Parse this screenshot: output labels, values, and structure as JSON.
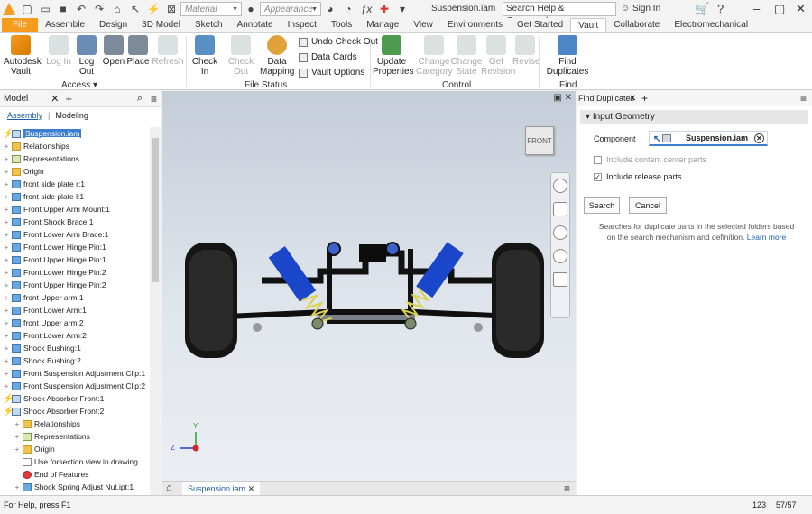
{
  "qat": {
    "material_placeholder": "Material",
    "appearance_placeholder": "Appearance",
    "doc_title": "Suspension.iam",
    "search_placeholder": "Search Help & Commands...",
    "signin": "Sign In"
  },
  "tabs": [
    "File",
    "Assemble",
    "Design",
    "3D Model",
    "Sketch",
    "Annotate",
    "Inspect",
    "Tools",
    "Manage",
    "View",
    "Environments",
    "Get Started",
    "Vault",
    "Collaborate",
    "Electromechanical"
  ],
  "active_tab": "Vault",
  "ribbon": {
    "autodesk_vault": "Autodesk Vault",
    "login": "Log In",
    "logout": "Log Out",
    "open": "Open",
    "place": "Place",
    "refresh": "Refresh",
    "checkin": "Check In",
    "checkout": "Check Out",
    "data_mapping": "Data Mapping",
    "undo_checkout": "Undo Check Out",
    "data_cards": "Data Cards",
    "vault_options": "Vault Options",
    "update_properties": "Update Properties",
    "change_category": "Change Category",
    "change_state": "Change State",
    "get_revision": "Get Revision",
    "revise": "Revise",
    "find_duplicates": "Find Duplicates",
    "panel_access": "Access",
    "panel_file_status": "File Status",
    "panel_control": "Control",
    "panel_find": "Find"
  },
  "browser": {
    "title": "Model",
    "subtab_assembly": "Assembly",
    "subtab_modeling": "Modeling",
    "nodes": [
      {
        "label": "Suspension.iam",
        "icon": "asm",
        "bolt": true,
        "sel": true,
        "indent": 0,
        "exp": ""
      },
      {
        "label": "Relationships",
        "icon": "folder",
        "indent": 0,
        "exp": "+"
      },
      {
        "label": "Representations",
        "icon": "rep",
        "indent": 0,
        "exp": "+"
      },
      {
        "label": "Origin",
        "icon": "folder",
        "indent": 0,
        "exp": "+"
      },
      {
        "label": "front side plate r:1",
        "icon": "part",
        "indent": 0,
        "exp": "+"
      },
      {
        "label": "front side plate l:1",
        "icon": "part",
        "indent": 0,
        "exp": "+"
      },
      {
        "label": "Front Upper Arm Mount:1",
        "icon": "part",
        "indent": 0,
        "exp": "+"
      },
      {
        "label": "Front Shock Brace:1",
        "icon": "part",
        "indent": 0,
        "exp": "+"
      },
      {
        "label": "Front Lower Arm Brace:1",
        "icon": "part",
        "indent": 0,
        "exp": "+"
      },
      {
        "label": "Front Lower Hinge Pin:1",
        "icon": "part",
        "indent": 0,
        "exp": "+"
      },
      {
        "label": "Front Upper Hinge Pin:1",
        "icon": "part",
        "indent": 0,
        "exp": "+"
      },
      {
        "label": "Front Lower Hinge Pin:2",
        "icon": "part",
        "indent": 0,
        "exp": "+"
      },
      {
        "label": "Front Upper Hinge Pin:2",
        "icon": "part",
        "indent": 0,
        "exp": "+"
      },
      {
        "label": "front Upper arm:1",
        "icon": "part",
        "indent": 0,
        "exp": "+"
      },
      {
        "label": "Front Lower Arm:1",
        "icon": "part",
        "indent": 0,
        "exp": "+"
      },
      {
        "label": "front Upper arm:2",
        "icon": "part",
        "indent": 0,
        "exp": "+"
      },
      {
        "label": "Front Lower Arm:2",
        "icon": "part",
        "indent": 0,
        "exp": "+"
      },
      {
        "label": "Shock Bushing:1",
        "icon": "part",
        "indent": 0,
        "exp": "+"
      },
      {
        "label": "Shock Bushing:2",
        "icon": "part",
        "indent": 0,
        "exp": "+"
      },
      {
        "label": "Front Suspension Adjustment Clip:1",
        "icon": "part",
        "indent": 0,
        "exp": "+"
      },
      {
        "label": "Front Suspension Adjustment Clip:2",
        "icon": "part",
        "indent": 0,
        "exp": "+"
      },
      {
        "label": "Shock Absorber Front:1",
        "icon": "asm",
        "bolt": true,
        "indent": 0,
        "exp": "+"
      },
      {
        "label": "Shock Absorber Front:2",
        "icon": "asm",
        "bolt": true,
        "indent": 0,
        "exp": "-"
      },
      {
        "label": "Relationships",
        "icon": "folder",
        "indent": 1,
        "exp": "+"
      },
      {
        "label": "Representations",
        "icon": "rep",
        "indent": 1,
        "exp": "+"
      },
      {
        "label": "Origin",
        "icon": "folder",
        "indent": 1,
        "exp": "+"
      },
      {
        "label": "Use forsection view in drawing",
        "icon": "rel",
        "indent": 1,
        "exp": ""
      },
      {
        "label": "End of Features",
        "icon": "err",
        "indent": 1,
        "exp": ""
      },
      {
        "label": "Shock Spring Adjust Nut.ipt:1",
        "icon": "part",
        "indent": 1,
        "exp": "+"
      }
    ]
  },
  "viewport": {
    "viewcube_label": "FRONT",
    "axis_y": "Y",
    "axis_z": "Z",
    "doc_tab": "Suspension.iam"
  },
  "find_duplicates": {
    "title": "Find Duplicates",
    "section": "Input Geometry",
    "component_label": "Component",
    "component_value": "Suspension.iam",
    "include_content_center": "Include content center parts",
    "include_release": "Include release parts",
    "search": "Search",
    "cancel": "Cancel",
    "note": "Searches for duplicate parts in the selected folders based on the search mechanism and definition.",
    "learn_more": "Learn more"
  },
  "status": {
    "help": "For Help, press F1",
    "count1": "123",
    "count2": "57/57"
  },
  "colors": {
    "file_tab": "#f59b1d",
    "accent": "#3c7fd0"
  }
}
